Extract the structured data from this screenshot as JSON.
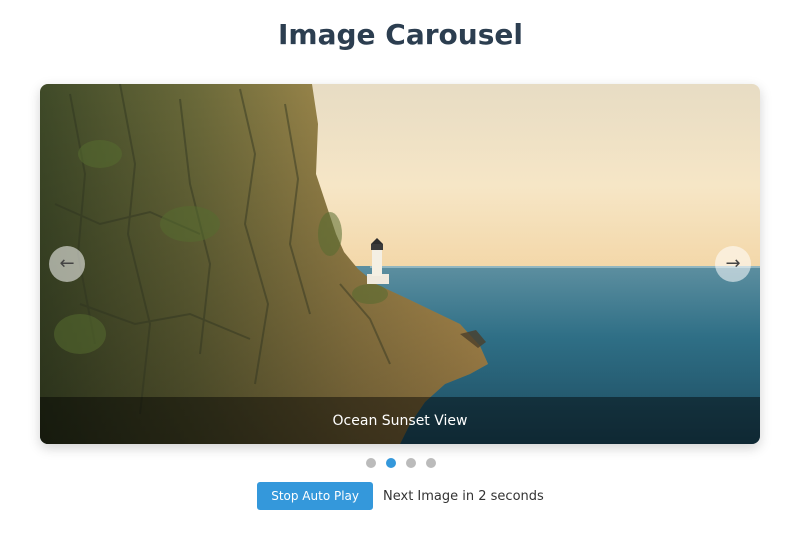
{
  "page": {
    "title": "Image Carousel"
  },
  "carousel": {
    "prev_icon": "←",
    "next_icon": "→",
    "caption": "Ocean Sunset View",
    "slide_count": 4,
    "active_index": 1,
    "image_subject": "sea-cliff-with-lighthouse"
  },
  "controls": {
    "autoplay_label": "Stop Auto Play",
    "status_text": "Next Image in 2 seconds"
  },
  "colors": {
    "title": "#2c3e50",
    "accent": "#3498db",
    "dot_inactive": "#bbbbbb"
  }
}
